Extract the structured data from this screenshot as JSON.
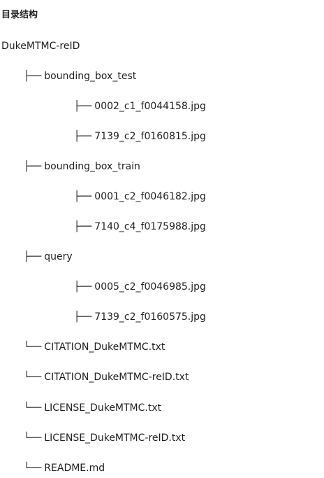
{
  "heading": "目录结构",
  "branch_mid": "├──",
  "branch_last": "└──",
  "tree": {
    "root": "DukeMTMC-reID",
    "bounding_box_test": {
      "name": "bounding_box_test",
      "files": [
        "0002_c1_f0044158.jpg",
        "7139_c2_f0160815.jpg"
      ]
    },
    "bounding_box_train": {
      "name": "bounding_box_train",
      "files": [
        "0001_c2_f0046182.jpg",
        "7140_c4_f0175988.jpg"
      ]
    },
    "query": {
      "name": "query",
      "files": [
        "0005_c2_f0046985.jpg",
        "7139_c2_f0160575.jpg"
      ]
    },
    "root_files": [
      "CITATION_DukeMTMC.txt",
      "CITATION_DukeMTMC-reID.txt",
      "LICENSE_DukeMTMC.txt",
      "LICENSE_DukeMTMC-reID.txt",
      "README.md"
    ]
  }
}
